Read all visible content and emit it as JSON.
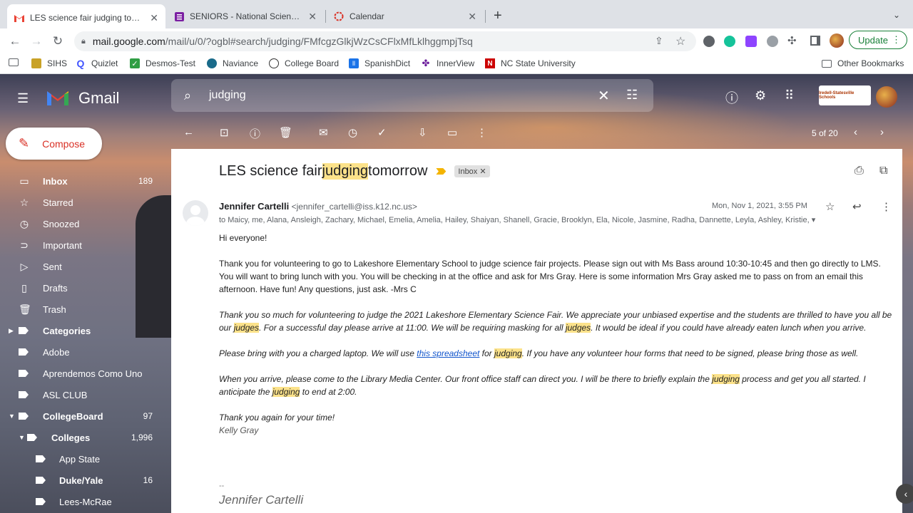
{
  "browser": {
    "tabs": [
      {
        "title": "LES science fair judging tomorr",
        "icon": "gmail-icon"
      },
      {
        "title": "SENIORS - National Science Ho",
        "icon": "classroom-icon"
      },
      {
        "title": "Calendar",
        "icon": "calendar-icon"
      }
    ],
    "url_host": "mail.google.com",
    "url_path": "/mail/u/0/?ogbl#search/judging/FMfcgzGlkjWzCsCFlxMfLklhggmpjTsq",
    "update_label": "Update",
    "bookmarks": [
      "SIHS",
      "Quizlet",
      "Desmos-Test",
      "Naviance",
      "College Board",
      "SpanishDict",
      "InnerView",
      "NC State University"
    ],
    "other_bookmarks": "Other Bookmarks"
  },
  "gmail": {
    "brand": "Gmail",
    "search_query": "judging",
    "org_logo_text": "Iredell-Statesville Schools",
    "compose_label": "Compose",
    "pagination": "5 of 20",
    "sidebar": [
      {
        "label": "Inbox",
        "count": "189",
        "bold": true,
        "icon": "inbox-icon"
      },
      {
        "label": "Starred",
        "count": "",
        "bold": false,
        "icon": "star-icon"
      },
      {
        "label": "Snoozed",
        "count": "",
        "bold": false,
        "icon": "clock-icon"
      },
      {
        "label": "Important",
        "count": "",
        "bold": false,
        "icon": "important-icon"
      },
      {
        "label": "Sent",
        "count": "",
        "bold": false,
        "icon": "send-icon"
      },
      {
        "label": "Drafts",
        "count": "",
        "bold": false,
        "icon": "draft-icon"
      },
      {
        "label": "Trash",
        "count": "",
        "bold": false,
        "icon": "trash-icon"
      },
      {
        "label": "Categories",
        "count": "",
        "bold": true,
        "icon": "label-icon"
      },
      {
        "label": "Adobe",
        "count": "",
        "bold": false,
        "icon": "label-icon"
      },
      {
        "label": "Aprendemos Como Uno",
        "count": "",
        "bold": false,
        "icon": "label-icon"
      },
      {
        "label": "ASL CLUB",
        "count": "",
        "bold": false,
        "icon": "label-icon"
      },
      {
        "label": "CollegeBoard",
        "count": "97",
        "bold": true,
        "icon": "label-icon"
      },
      {
        "label": "Colleges",
        "count": "1,996",
        "bold": true,
        "icon": "label-icon"
      },
      {
        "label": "App State",
        "count": "",
        "bold": false,
        "icon": "label-icon"
      },
      {
        "label": "Duke/Yale",
        "count": "16",
        "bold": true,
        "icon": "label-icon"
      },
      {
        "label": "Lees-McRae",
        "count": "",
        "bold": false,
        "icon": "label-icon"
      }
    ]
  },
  "message": {
    "subject_pre": "LES science fair ",
    "subject_hl": "judging",
    "subject_post": " tomorrow",
    "inbox_chip": "Inbox",
    "sender_name": "Jennifer Cartelli",
    "sender_email": "<jennifer_cartelli@iss.k12.nc.us>",
    "recipients": "to Maicy, me, Alana, Ansleigh, Zachary, Michael, Emelia, Amelia, Hailey, Shaiyan, Shanell, Gracie, Brooklyn, Ela, Nicole, Jasmine, Radha, Dannette, Leyla, Ashley, Kristie,",
    "date": "Mon, Nov 1, 2021, 3:55 PM",
    "greeting": "Hi everyone!",
    "para1": "Thank you for volunteering to go to Lakeshore Elementary School to judge science fair projects. Please sign out with Ms Bass around 10:30-10:45 and then go directly to LMS. You will want to bring lunch with you. You will be checking in at the office and ask for Mrs Gray. Here is some information Mrs Gray asked me to pass on from an email this afternoon. Have fun! Any questions, just ask. -Mrs C",
    "q1_a": "Thank you so much for volunteering to judge the 2021 Lakeshore Elementary Science Fair. We appreciate your unbiased expertise and the students are thrilled to have you all be our ",
    "q1_hl1": "judges",
    "q1_b": ". For a successful day please arrive at 11:00. We will be requiring masking for all ",
    "q1_hl2": "judges",
    "q1_c": ". It would be ideal if you could have already eaten lunch when you arrive.",
    "q2_a": "Please bring with you a charged laptop. We will use ",
    "q2_link": "this spreadsheet",
    "q2_b": " for ",
    "q2_hl": "judging",
    "q2_c": ". If you have any volunteer hour forms that need to be signed, please bring those as well.",
    "q3_a": "When you arrive, please come to the Library Media Center. Our front office staff can direct you. I will be there to briefly explain the ",
    "q3_hl1": "judging",
    "q3_b": " process and get you all started. I anticipate the ",
    "q3_hl2": "judging",
    "q3_c": " to end at 2:00.",
    "thanks": "Thank you again for your time!",
    "kelly": "Kelly Gray",
    "sig_sep": "--",
    "sig_name": "Jennifer Cartelli"
  }
}
